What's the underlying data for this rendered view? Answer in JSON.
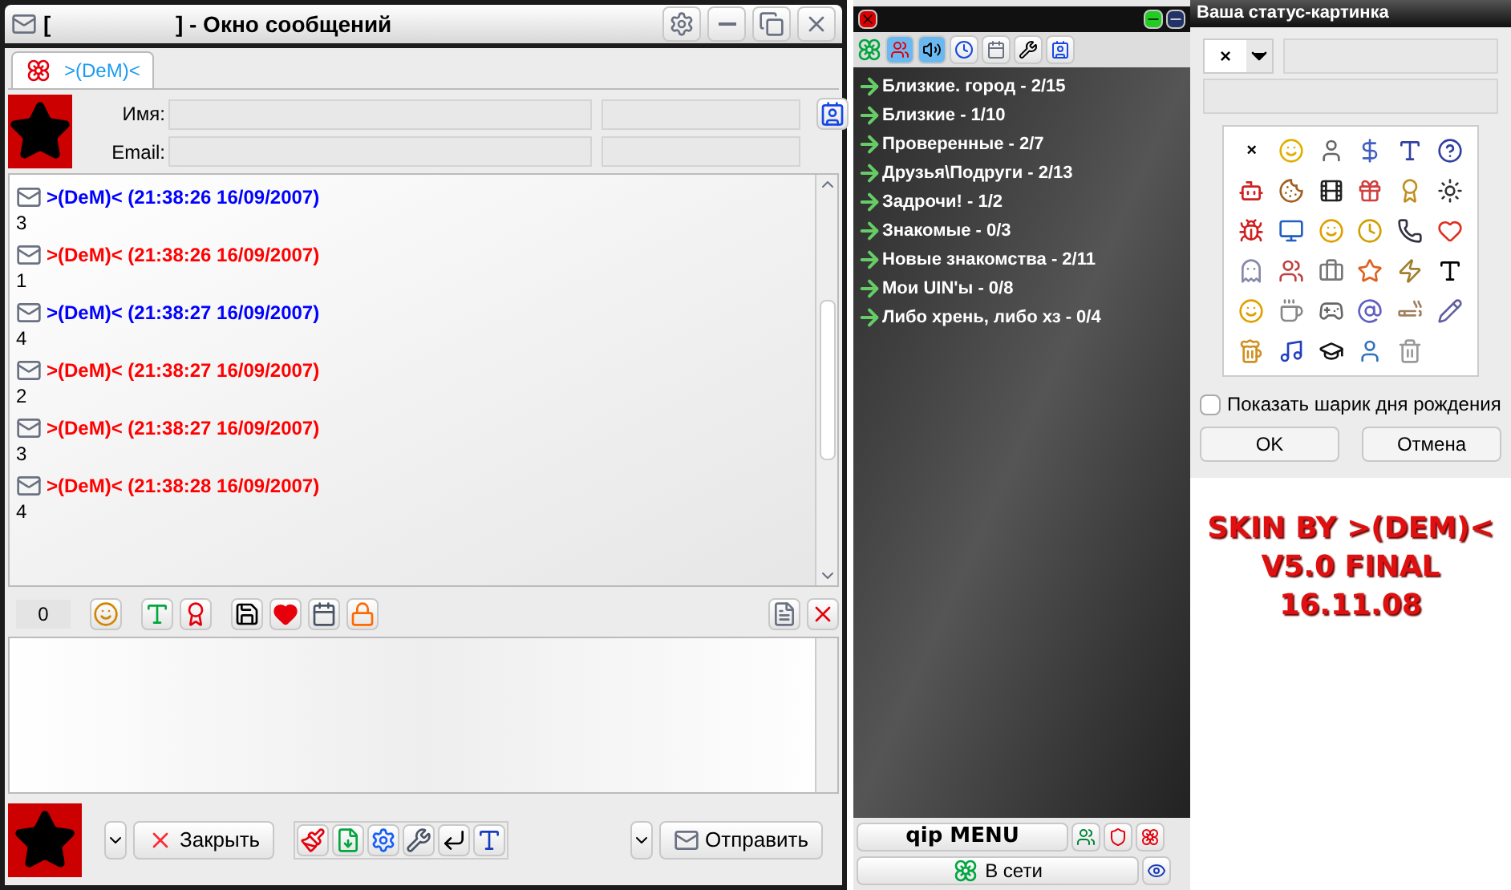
{
  "chat_window": {
    "title": "[                    ] - Окно сообщений",
    "tab": {
      "label": ">(DeM)<",
      "selected": true
    },
    "fields": [
      {
        "label": "Имя:"
      },
      {
        "label": "Email:"
      }
    ],
    "messages": [
      {
        "kind": "outgoing",
        "header": ">(DeM)< (21:38:26 16/09/2007)",
        "text": "3"
      },
      {
        "kind": "incoming",
        "header": ">(DeM)< (21:38:26 16/09/2007)",
        "text": "1"
      },
      {
        "kind": "outgoing",
        "header": ">(DeM)< (21:38:27 16/09/2007)",
        "text": "4"
      },
      {
        "kind": "incoming",
        "header": ">(DeM)< (21:38:27 16/09/2007)",
        "text": "2"
      },
      {
        "kind": "incoming",
        "header": ">(DeM)< (21:38:27 16/09/2007)",
        "text": "3"
      },
      {
        "kind": "incoming",
        "header": ">(DeM)< (21:38:28 16/09/2007)",
        "text": "4"
      }
    ],
    "char_count": "0",
    "close_button": "Закрыть",
    "send_button": "Отправить"
  },
  "contact_list": {
    "groups": [
      {
        "label": "Близкие. город - 2/15"
      },
      {
        "label": "Близкие - 1/10"
      },
      {
        "label": "Проверенные - 2/7"
      },
      {
        "label": "Друзья\\Подруги - 2/13"
      },
      {
        "label": "Задрочи! - 1/2"
      },
      {
        "label": "Знакомые - 0/3"
      },
      {
        "label": "Новые знакомства - 2/11"
      },
      {
        "label": "Мои UIN'ы - 0/8"
      },
      {
        "label": "Либо хрень, либо хз - 0/4"
      }
    ],
    "menu_button": "qip MENU",
    "status_button": "В сети"
  },
  "status_dialog": {
    "title": "Ваша статус-картинка",
    "selected_symbol": "×",
    "grid_first": "×",
    "birthday_checkbox": {
      "label": "Показать шарик дня рождения",
      "checked": false
    },
    "ok_button": "OK",
    "cancel_button": "Отмена"
  },
  "skin_caption": [
    "SKIN BY >(DEM)<",
    "V5.0 FINAL",
    "16.11.08"
  ]
}
